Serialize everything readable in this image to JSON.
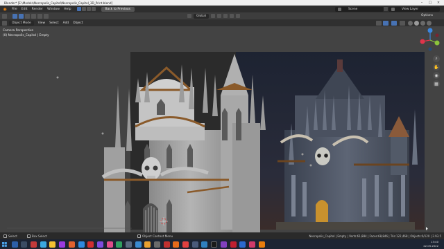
{
  "window": {
    "title": "Blender* [E:\\Models\\Necropolis_Capitol\\Necropolis_Capitol_3D_Print.blend]"
  },
  "menubar": {
    "items": [
      "File",
      "Edit",
      "Render",
      "Window",
      "Help"
    ],
    "back_button": "Back to Previous",
    "scene": "Scene",
    "view_layer": "View Layer"
  },
  "toolbar": {
    "orientation": "Global",
    "options": "Options"
  },
  "viewport_header": {
    "mode": "Object Mode",
    "menus": [
      "View",
      "Select",
      "Add",
      "Object"
    ]
  },
  "viewport": {
    "camera_label": "Camera Perspective",
    "object_label": "(0) Necropolis_Capitol | Empty"
  },
  "statusbar": {
    "select": "Select",
    "box_select": "Box Select",
    "context_menu": "Object Context Menu",
    "stats": "Necropolis_Capitol | Empty | Verts:61,884 | Faces:68,846 | Tris:122,468 | Objects:0/120 | 2.93.5"
  },
  "taskbar": {
    "time": "13:40",
    "date": "22.05.2022"
  },
  "colors": {
    "accent": "#4772b3",
    "viewport_bg": "#434343",
    "axis_x": "#e0344a",
    "axis_y": "#8bc43b",
    "axis_z": "#3b87e0"
  },
  "icons": {
    "nav": [
      "zoom-icon",
      "pan-hand-icon",
      "camera-icon",
      "perspective-grid-icon"
    ]
  }
}
